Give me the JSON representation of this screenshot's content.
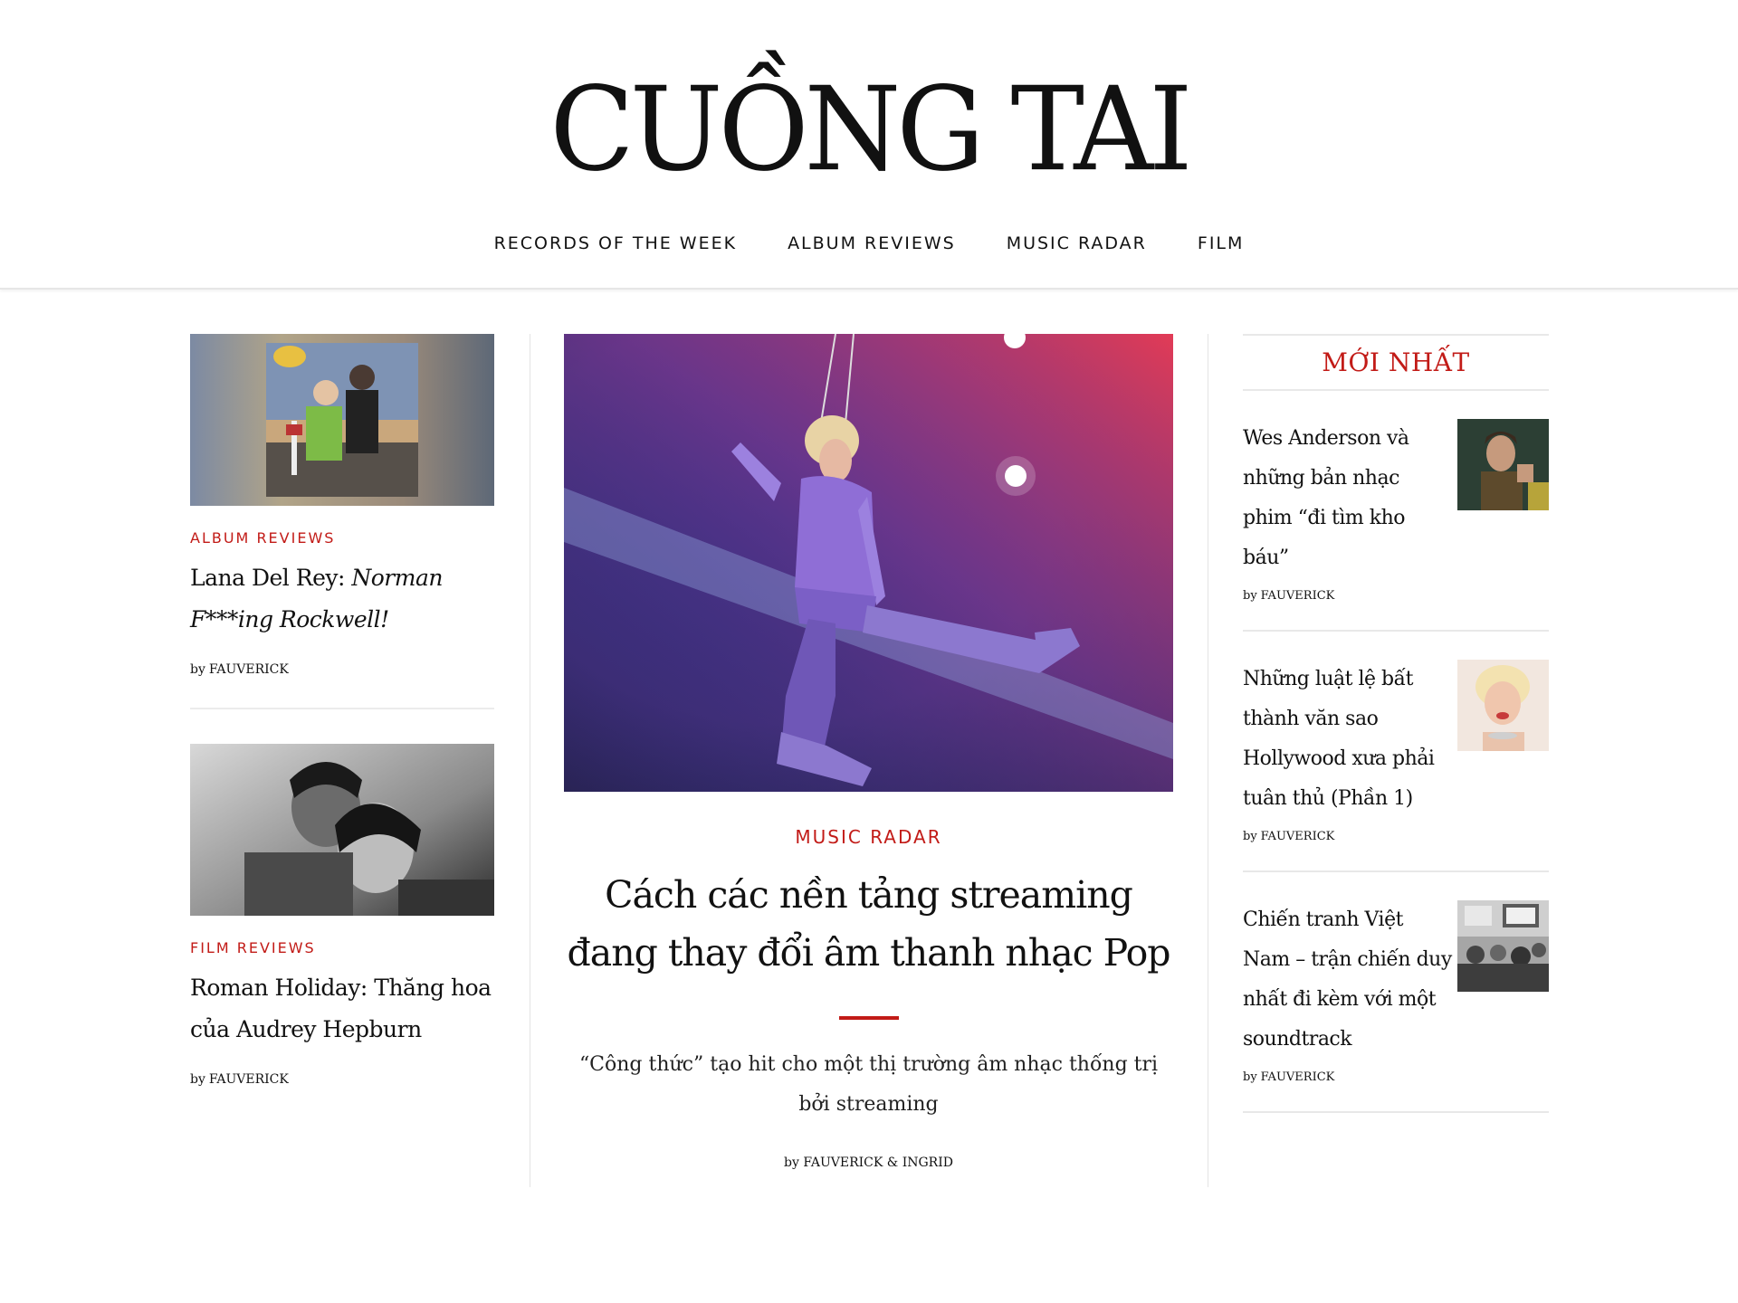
{
  "site": {
    "logo": "CUỒNG TAI"
  },
  "nav": {
    "items": [
      {
        "label": "RECORDS OF THE WEEK"
      },
      {
        "label": "ALBUM REVIEWS"
      },
      {
        "label": "MUSIC RADAR"
      },
      {
        "label": "FILM"
      }
    ]
  },
  "left": {
    "posts": [
      {
        "category": "ALBUM REVIEWS",
        "title_plain": "Lana Del Rey: ",
        "title_italic": "Norman F***ing Rockwell!",
        "by": "by",
        "author": "FAUVERICK",
        "image": "album-cover-photo"
      },
      {
        "category": "FILM REVIEWS",
        "title_plain": "Roman Holiday: Thăng hoa của Audrey Hepburn",
        "title_italic": "",
        "by": "by",
        "author": "FAUVERICK",
        "image": "black-and-white-film-still"
      }
    ]
  },
  "feature": {
    "category": "MUSIC RADAR",
    "title": "Cách các nền tảng streaming đang thay đổi âm thanh nhạc Pop",
    "excerpt": "“Công thức” tạo hit cho một thị trường âm nhạc thống trị bởi streaming",
    "by": "by",
    "author": "FAUVERICK & INGRID",
    "image": "performer-on-wires-stage-photo"
  },
  "sidebar": {
    "heading": "MỚI NHẤT",
    "posts": [
      {
        "title": "Wes Anderson và những bản nhạc phim “đi tìm kho báu”",
        "by": "by",
        "author": "FAUVERICK",
        "image": "portrait-photo"
      },
      {
        "title": "Những luật lệ bất thành văn sao Hollywood xưa phải tuân thủ (Phần 1)",
        "by": "by",
        "author": "FAUVERICK",
        "image": "vintage-portrait-photo"
      },
      {
        "title": "Chiến tranh Việt Nam – trận chiến duy nhất đi kèm với một soundtrack",
        "by": "by",
        "author": "FAUVERICK",
        "image": "protest-crowd-photo"
      }
    ]
  },
  "colors": {
    "accent": "#c21b17",
    "text": "#111111",
    "rule": "#e8e8e8"
  }
}
